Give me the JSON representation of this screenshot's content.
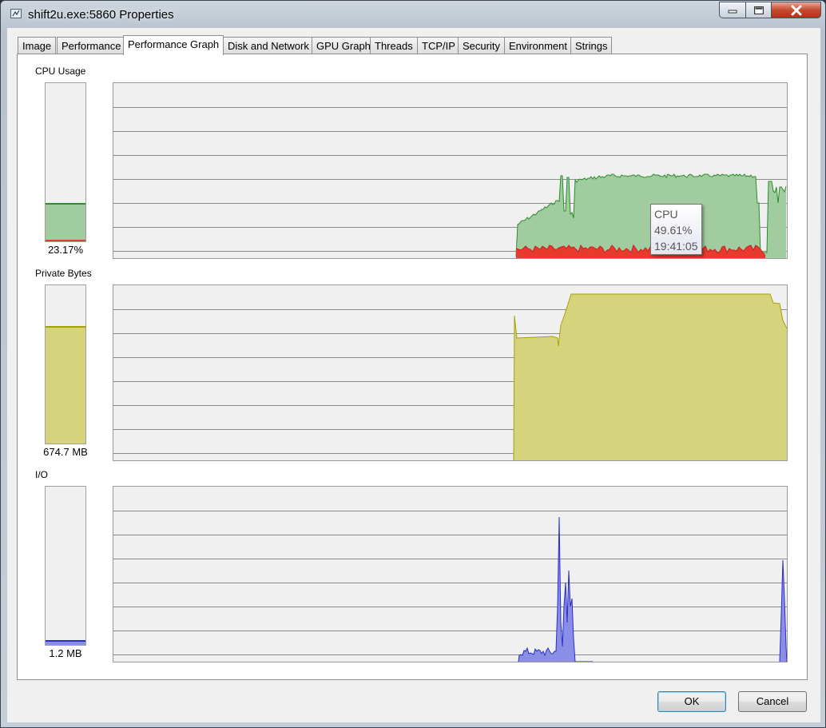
{
  "window": {
    "title": "shift2u.exe:5860 Properties",
    "icon": "process-explorer-icon"
  },
  "tabs": [
    {
      "label": "Image",
      "active": false
    },
    {
      "label": "Performance",
      "active": false
    },
    {
      "label": "Performance Graph",
      "active": true
    },
    {
      "label": "Disk and Network",
      "active": false
    },
    {
      "label": "GPU Graph",
      "active": false
    },
    {
      "label": "Threads",
      "active": false
    },
    {
      "label": "TCP/IP",
      "active": false
    },
    {
      "label": "Security",
      "active": false
    },
    {
      "label": "Environment",
      "active": false
    },
    {
      "label": "Strings",
      "active": false
    }
  ],
  "cpu": {
    "label": "CPU Usage",
    "value": "23.17%",
    "level": 0.2317,
    "kernel_level": 0.01,
    "fill_color": "#a0cca0",
    "line_color": "#2e8b2e",
    "kernel_color": "#e8392e"
  },
  "private_bytes": {
    "label": "Private Bytes",
    "value": "674.7 MB",
    "level": 0.73,
    "fill_color": "#d5d37c",
    "line_color": "#a8a200"
  },
  "io": {
    "label": "I/O",
    "value": "1.2  MB",
    "level": 0.02,
    "fill_color": "#8a8ee6",
    "line_color": "#2a2ec8"
  },
  "tooltip": {
    "series": "CPU",
    "value": "49.61%",
    "time": "19:41:05"
  },
  "buttons": {
    "ok": "OK",
    "cancel": "Cancel"
  }
}
